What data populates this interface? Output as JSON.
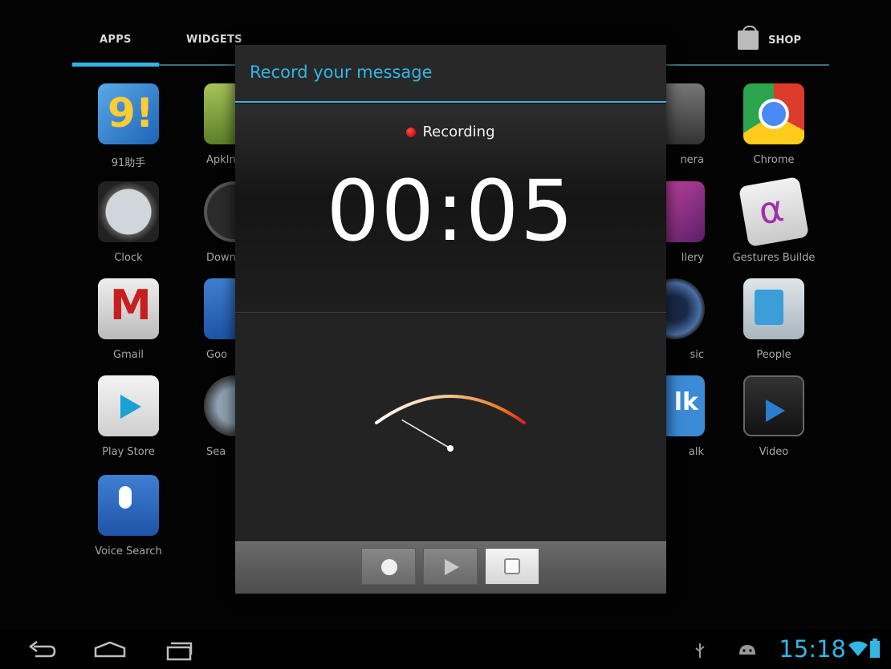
{
  "launcher": {
    "tabs": [
      "APPS",
      "WIDGETS"
    ],
    "shop_label": "SHOP",
    "apps": {
      "app91": "91助手",
      "apkin": "ApkIn",
      "camera": "nera",
      "chrome": "Chrome",
      "clock": "Clock",
      "downloads": "Down",
      "gallery": "llery",
      "gestures": "Gestures Builde",
      "gmail": "Gmail",
      "google": "Goo",
      "music": "sic",
      "people": "People",
      "playstore": "Play Store",
      "search": "Sea",
      "talk": "lk",
      "talk_label": "alk",
      "video": "Video",
      "voice": "Voice Search"
    }
  },
  "dialog": {
    "title": "Record your message",
    "status": "Recording",
    "timer": "00:05",
    "meter_level": 0.05,
    "controls": {
      "record": "record",
      "play": "play",
      "stop": "stop"
    }
  },
  "statusbar": {
    "time": "15:18"
  },
  "colors": {
    "accent": "#33b5e5",
    "record_red": "#d40000"
  }
}
